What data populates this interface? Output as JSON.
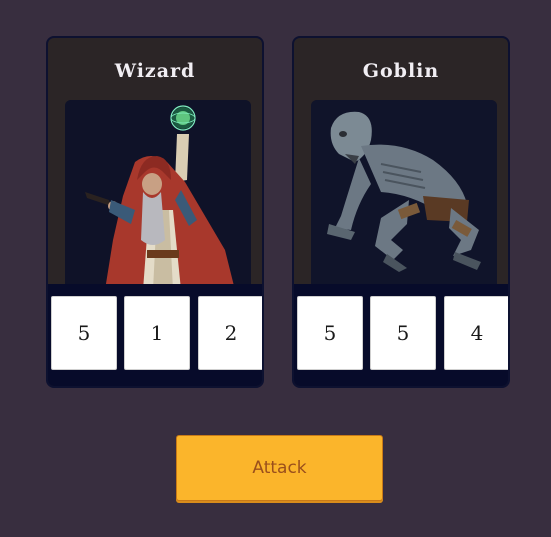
{
  "cards": {
    "wizard": {
      "name": "Wizard",
      "stats": [
        "5",
        "1",
        "2"
      ]
    },
    "goblin": {
      "name": "Goblin",
      "stats": [
        "5",
        "5",
        "4"
      ]
    }
  },
  "actions": {
    "attack_label": "Attack"
  },
  "colors": {
    "background": "#382e3f",
    "card_background": "#2b2526",
    "stats_bar": "#070b2a",
    "attack_button": "#fbb52b",
    "attack_text": "#9a4f1c"
  }
}
